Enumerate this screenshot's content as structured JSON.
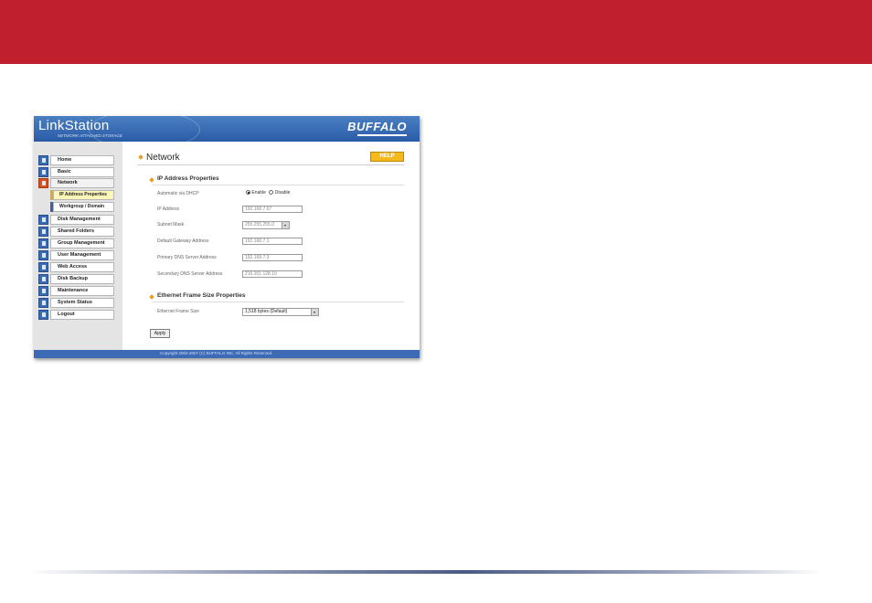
{
  "app": {
    "brand": "LinkStation",
    "brand_sub": "NETWORK ATTACHED STORAGE",
    "logo": "BUFFALO"
  },
  "colors": {
    "banner": "#c0202e",
    "header_blue": "#2a5ca6",
    "help_orange": "#f5b91c",
    "active_sub": "#fdf6b8"
  },
  "sidebar": {
    "items": [
      {
        "label": "Home",
        "icon": "home-icon"
      },
      {
        "label": "Basic",
        "icon": "basic-icon"
      },
      {
        "label": "Network",
        "icon": "network-icon",
        "active": true
      },
      {
        "label": "Disk Management",
        "icon": "disk-icon"
      },
      {
        "label": "Shared Folders",
        "icon": "folder-icon"
      },
      {
        "label": "Group Management",
        "icon": "group-icon"
      },
      {
        "label": "User Management",
        "icon": "user-icon"
      },
      {
        "label": "Web Access",
        "icon": "web-icon"
      },
      {
        "label": "Disk Backup",
        "icon": "backup-icon"
      },
      {
        "label": "Maintenance",
        "icon": "maintenance-icon"
      },
      {
        "label": "System Status",
        "icon": "status-icon"
      },
      {
        "label": "Logout",
        "icon": "logout-icon"
      }
    ],
    "subitems": [
      {
        "label": "IP Address Properties",
        "active": true
      },
      {
        "label": "Workgroup / Domain"
      }
    ]
  },
  "main": {
    "title": "Network",
    "help_label": "HELP",
    "ip_section": {
      "title": "IP Address Properties",
      "dhcp_label": "Automatic via DHCP",
      "enable_label": "Enable",
      "disable_label": "Disable",
      "ip_label": "IP Address",
      "ip_value": "192.168.7.67",
      "subnet_label": "Subnet Mask",
      "subnet_value": "255.255.255.0",
      "gateway_label": "Default Gateway Address",
      "gateway_value": "192.168.7.1",
      "dns1_label": "Primary DNS Server Address",
      "dns1_value": "192.168.7.3",
      "dns2_label": "Secondary DNS Server Address",
      "dns2_value": "216.201.128.10"
    },
    "frame_section": {
      "title": "Ethernet Frame Size Properties",
      "frame_label": "Ethernet Frame Size",
      "frame_value": "1,518 bytes (Default)"
    },
    "apply_label": "Apply"
  },
  "footer": {
    "copyright": "Copyright 2002-2007 (C) BUFFALO INC. All Rights Reserved."
  }
}
